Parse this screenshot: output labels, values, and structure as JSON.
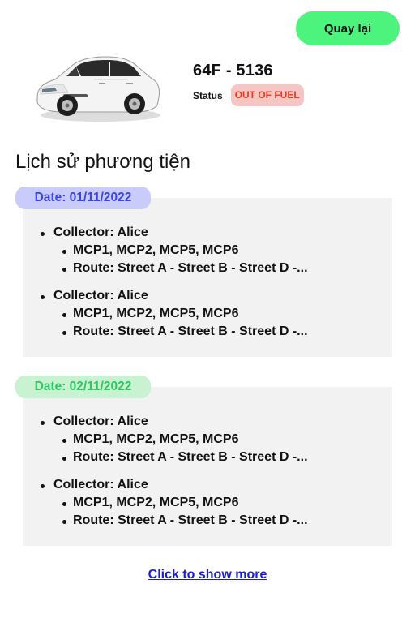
{
  "header": {
    "back_label": "Quay lại"
  },
  "vehicle": {
    "plate": "64F - 5136",
    "status_label": "Status",
    "status_value": "OUT OF FUEL",
    "image_icon": "car-image"
  },
  "history": {
    "title": "Lịch sử phương tiện",
    "groups": [
      {
        "date": "Date: 01/11/2022",
        "entries": [
          {
            "collector": "Collector: Alice",
            "mcps": "MCP1, MCP2, MCP5, MCP6",
            "route": "Route: Street A - Street B - Street D -..."
          },
          {
            "collector": "Collector: Alice",
            "mcps": "MCP1, MCP2, MCP5, MCP6",
            "route": "Route: Street A - Street B - Street D -..."
          }
        ]
      },
      {
        "date": "Date: 02/11/2022",
        "entries": [
          {
            "collector": "Collector: Alice",
            "mcps": "MCP1, MCP2, MCP5, MCP6",
            "route": "Route: Street A - Street B - Street D -..."
          },
          {
            "collector": "Collector: Alice",
            "mcps": "MCP1, MCP2, MCP5, MCP6",
            "route": "Route: Street A - Street B - Street D -..."
          }
        ]
      }
    ]
  },
  "footer": {
    "show_more_label": "Click to show more"
  },
  "colors": {
    "back_button": "#4cf47d",
    "status_badge_bg": "#f5c6c3",
    "status_badge_text": "#e23d1d",
    "date_blue_bg": "#c9cbfa",
    "date_blue_text": "#3b46e0",
    "date_green_bg": "#c8f2d2",
    "date_green_text": "#2ec760",
    "card_bg": "#f2f2f2",
    "link": "#1b1bd8"
  }
}
